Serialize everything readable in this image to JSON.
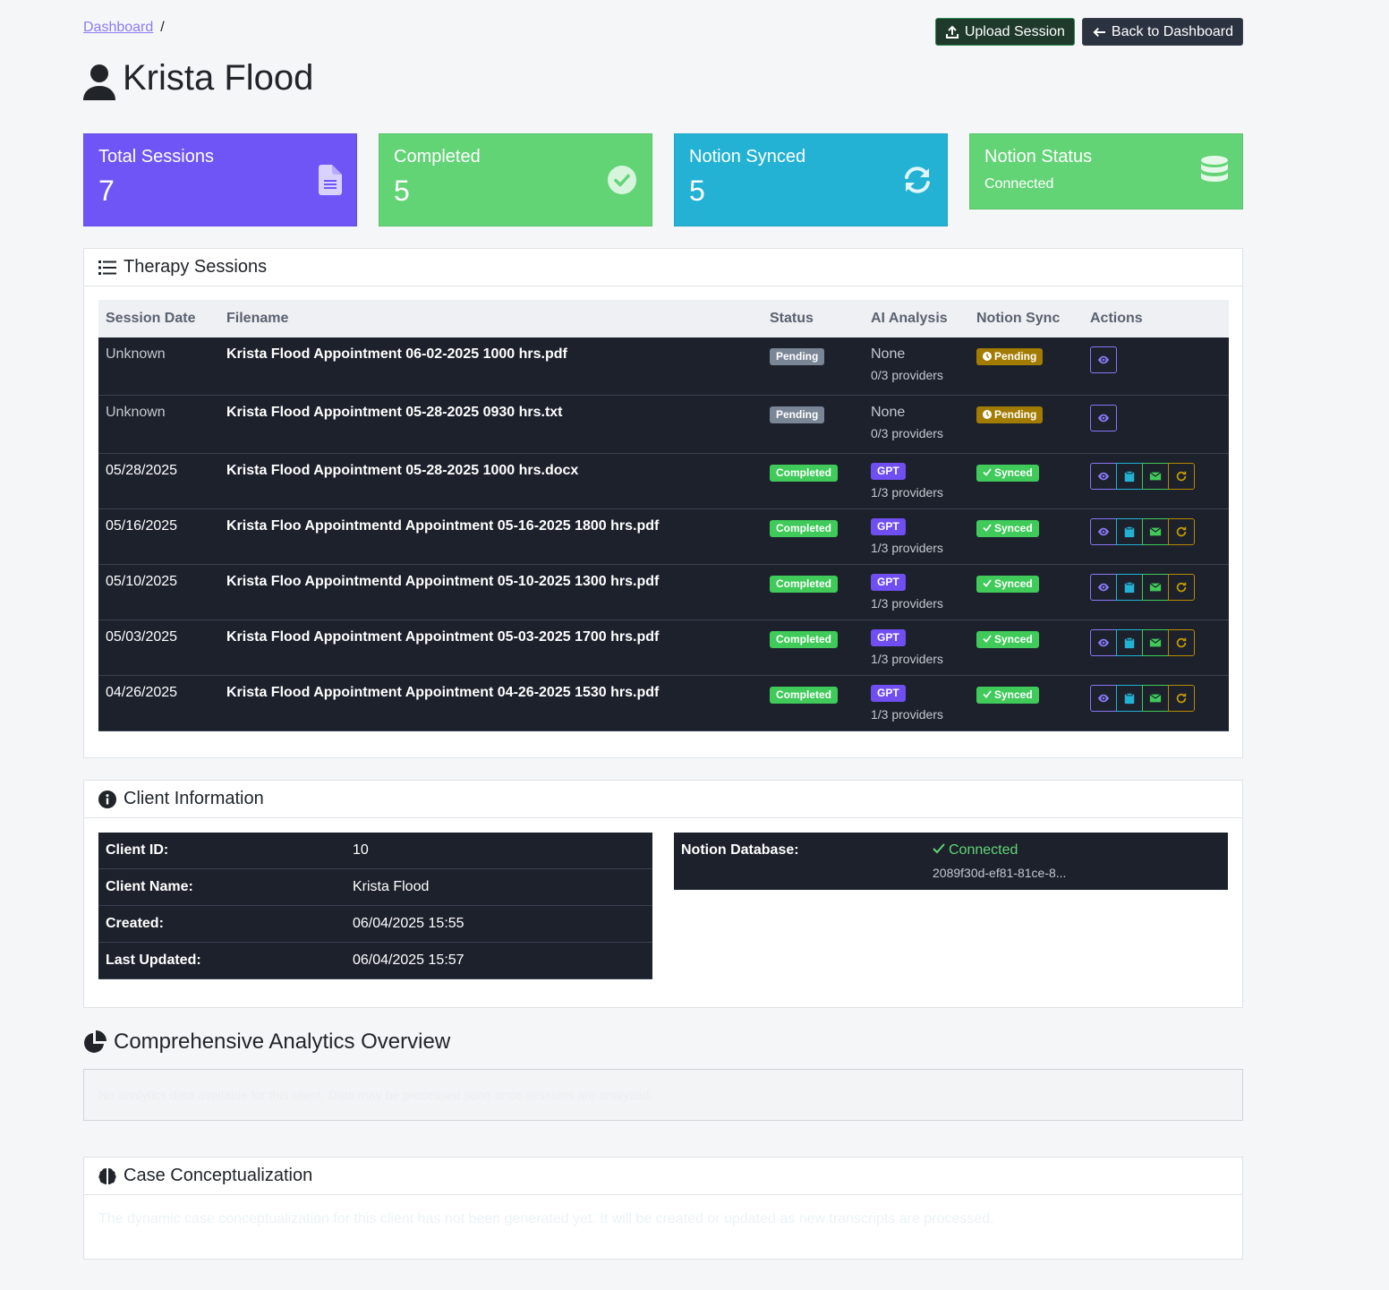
{
  "breadcrumb": {
    "link": "Dashboard",
    "separator": "/"
  },
  "actions": {
    "upload": "Upload Session",
    "back": "Back to Dashboard"
  },
  "client": {
    "name": "Krista Flood"
  },
  "stats": [
    {
      "label": "Total Sessions",
      "value": "7",
      "icon": "file-icon",
      "color": "#6f55f6"
    },
    {
      "label": "Completed",
      "value": "5",
      "icon": "check-circle-icon",
      "color": "#63d476"
    },
    {
      "label": "Notion Synced",
      "value": "5",
      "icon": "sync-icon",
      "color": "#23b2d4"
    },
    {
      "label": "Notion Status",
      "value": "Connected",
      "icon": "database-icon",
      "color": "#63d476"
    }
  ],
  "sessions": {
    "title": "Therapy Sessions",
    "headers": [
      "Session Date",
      "Filename",
      "Status",
      "AI Analysis",
      "Notion Sync",
      "Actions"
    ],
    "rows": [
      {
        "date": "Unknown",
        "file": "Krista Flood Appointment 06-02-2025 1000 hrs.pdf",
        "status": "Pending",
        "ai": "None",
        "providers": "0/3 providers",
        "sync": "Pending"
      },
      {
        "date": "Unknown",
        "file": "Krista Flood Appointment 05-28-2025 0930 hrs.txt",
        "status": "Pending",
        "ai": "None",
        "providers": "0/3 providers",
        "sync": "Pending"
      },
      {
        "date": "05/28/2025",
        "file": "Krista Flood Appointment 05-28-2025 1000 hrs.docx",
        "status": "Completed",
        "ai": "GPT",
        "providers": "1/3 providers",
        "sync": "Synced"
      },
      {
        "date": "05/16/2025",
        "file": "Krista Floo Appointmentd Appointment 05-16-2025 1800 hrs.pdf",
        "status": "Completed",
        "ai": "GPT",
        "providers": "1/3 providers",
        "sync": "Synced"
      },
      {
        "date": "05/10/2025",
        "file": "Krista Floo Appointmentd Appointment 05-10-2025 1300 hrs.pdf",
        "status": "Completed",
        "ai": "GPT",
        "providers": "1/3 providers",
        "sync": "Synced"
      },
      {
        "date": "05/03/2025",
        "file": "Krista Flood Appointment Appointment 05-03-2025 1700 hrs.pdf",
        "status": "Completed",
        "ai": "GPT",
        "providers": "1/3 providers",
        "sync": "Synced"
      },
      {
        "date": "04/26/2025",
        "file": "Krista Flood Appointment Appointment 04-26-2025 1530 hrs.pdf",
        "status": "Completed",
        "ai": "GPT",
        "providers": "1/3 providers",
        "sync": "Synced"
      }
    ]
  },
  "info": {
    "title": "Client Information",
    "rows": [
      {
        "key": "Client ID:",
        "value": "10"
      },
      {
        "key": "Client Name:",
        "value": "Krista Flood"
      },
      {
        "key": "Created:",
        "value": "06/04/2025 15:55"
      },
      {
        "key": "Last Updated:",
        "value": "06/04/2025 15:57"
      }
    ],
    "notion_label": "Notion Database:",
    "notion_status": "Connected",
    "notion_id": "2089f30d-ef81-81ce-8..."
  },
  "analytics": {
    "title": "Comprehensive Analytics Overview",
    "message": "No analytics data available for this client. Data may be processed soon once sessions are analyzed."
  },
  "case": {
    "title": "Case Conceptualization",
    "message": "The dynamic case conceptualization for this client has not been generated yet. It will be created or updated as new transcripts are processed."
  }
}
